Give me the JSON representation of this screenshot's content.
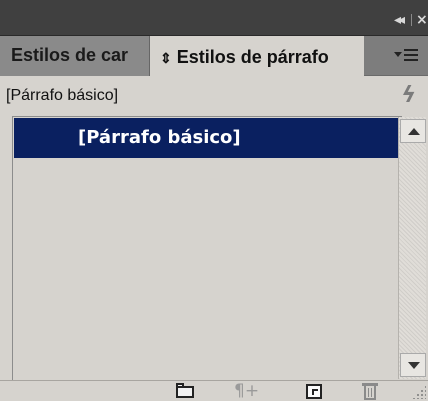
{
  "panel": {
    "title_bar": {
      "collapse_glyph": "◂◂",
      "close_glyph": "×",
      "icons": [
        "collapse-icon",
        "close-icon"
      ]
    },
    "tabs": [
      {
        "label": "Estilos de car",
        "active": false
      },
      {
        "label": "Estilos de párrafo",
        "active": true,
        "arrows_glyph": "⇕"
      }
    ],
    "menu_icon": "panel-menu-icon",
    "current_style": "[Párrafo básico]",
    "quick_apply_icon": "lightning-bolt-icon",
    "quick_apply_glyph": "ϟ",
    "list": {
      "items": [
        {
          "label": "[Párrafo básico]",
          "selected": true
        }
      ]
    },
    "bottom_toolbar": {
      "clear_overrides_glyph": "¶+",
      "icons": [
        "new-group-folder-icon",
        "clear-overrides-icon",
        "new-style-icon",
        "trash-icon",
        "resize-grip-icon"
      ]
    },
    "colors": {
      "titlebar": "#404040",
      "tabbar": "#7d7d7d",
      "panel_bg": "#d6d3ce",
      "selection": "#0a2060"
    }
  }
}
